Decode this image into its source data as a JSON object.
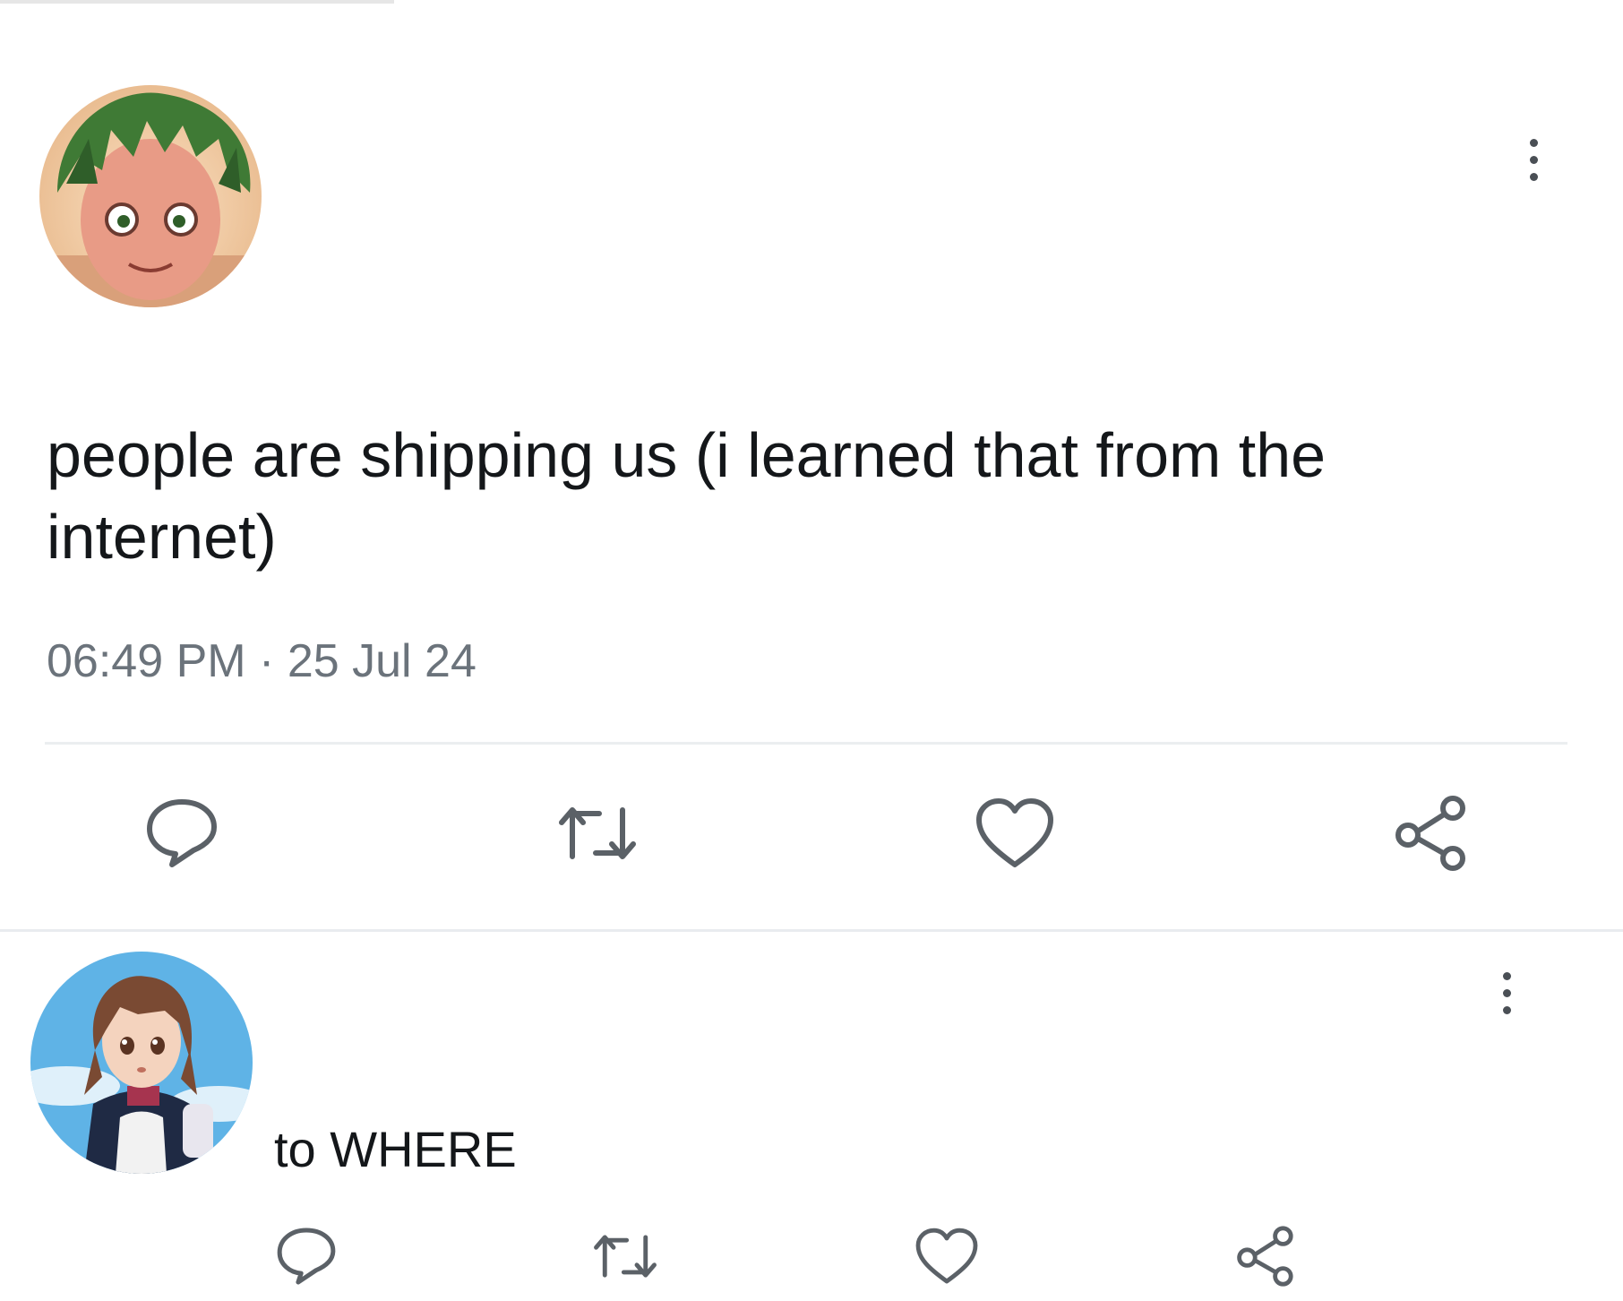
{
  "main_tweet": {
    "text": "people are shipping us (i learned that from the internet)",
    "time": "06:49 PM",
    "separator": "·",
    "date": "25 Jul 24",
    "avatar_icon": "anime-boy-avatar",
    "more_icon": "more-vertical-icon",
    "actions": [
      {
        "icon": "reply-icon"
      },
      {
        "icon": "retweet-icon"
      },
      {
        "icon": "heart-icon"
      },
      {
        "icon": "share-icon"
      }
    ]
  },
  "reply_tweet": {
    "text": "to WHERE",
    "avatar_icon": "anime-girl-avatar",
    "more_icon": "more-vertical-icon",
    "actions": [
      {
        "icon": "reply-icon"
      },
      {
        "icon": "retweet-icon"
      },
      {
        "icon": "heart-icon"
      },
      {
        "icon": "share-icon"
      }
    ]
  },
  "colors": {
    "text": "#14171a",
    "muted": "#6b737b",
    "icon": "#5b6167",
    "divider": "#ebeef0"
  }
}
